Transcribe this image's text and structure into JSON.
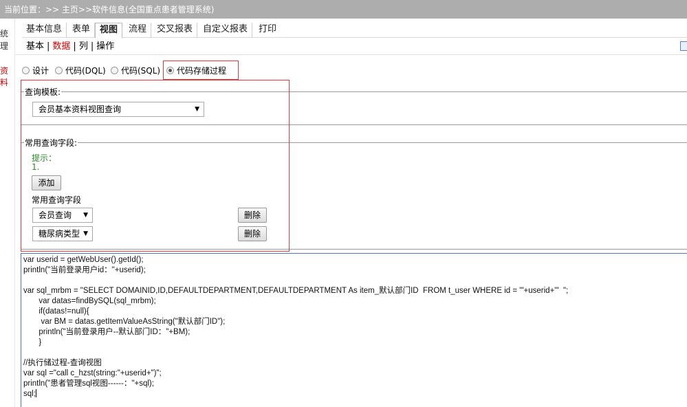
{
  "breadcrumb": {
    "text": "当前位置：>> 主页>>软件信息(全国重点患者管理系统)"
  },
  "left_strip": {
    "items": [
      "统",
      "理",
      "资料"
    ]
  },
  "tabs": [
    "基本信息",
    "表单",
    "视图",
    "流程",
    "交叉报表",
    "自定义报表",
    "打印"
  ],
  "active_tab": "视图",
  "subnav": {
    "items": [
      "基本",
      "数据",
      "列",
      "操作"
    ],
    "active": "数据"
  },
  "radio": {
    "options": [
      "设计",
      "代码(DQL)",
      "代码(SQL)",
      "代码存储过程"
    ],
    "selected": "代码存储过程"
  },
  "query_template": {
    "legend": "查询模板:",
    "selected": "会员基本资料视图查询"
  },
  "common_fields": {
    "legend": "常用查询字段:",
    "hint_label": "提示：",
    "hint_item": "1.",
    "add_button": "添加",
    "list_label": "常用查询字段",
    "rows": [
      {
        "value": "会员查询",
        "delete": "删除"
      },
      {
        "value": "糖尿病类型",
        "delete": "删除"
      }
    ]
  },
  "code_lines": [
    "var userid = getWebUser().getId();",
    "println(\"当前登录用户id：\"+userid);",
    "",
    "var sql_mrbm = \"SELECT DOMAINID,ID,DEFAULTDEPARTMENT,DEFAULTDEPARTMENT As item_默认部门ID  FROM t_user WHERE id = '\"+userid+\"'  \";",
    "       var datas=findBySQL(sql_mrbm);",
    "       if(datas!=null){",
    "        var BM = datas.getItemValueAsString(\"默认部门ID\");",
    "       println(\"当前登录用户--默认部门ID：\"+BM);",
    "       }",
    "",
    "//执行储过程-查询视图",
    "var sql =\"call c_hzst(string:\"+userid+\")\";",
    "println(\"患者管理sql视图------：\"+sql);",
    "sql;"
  ],
  "colors": {
    "topbar_bg": "#adadad",
    "highlight_red": "#e23a3a",
    "active_link_red": "#d40000",
    "hint_green": "#2a8a2a",
    "editor_border_blue": "#4a74c9"
  }
}
